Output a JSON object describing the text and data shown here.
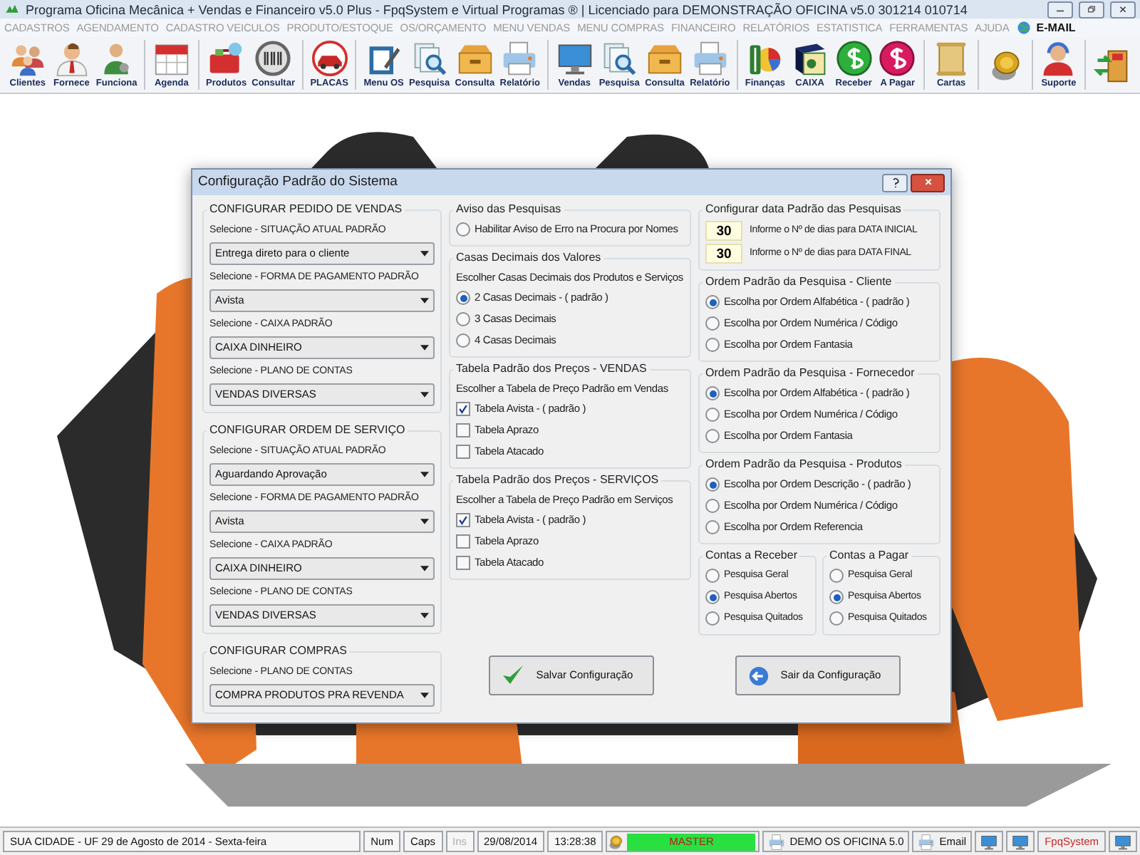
{
  "window": {
    "title": "Programa Oficina Mecânica + Vendas e Financeiro v5.0 Plus - FpqSystem e Virtual Programas ® | Licenciado para  DEMONSTRAÇÃO OFICINA v5.0 301214 010714"
  },
  "menu": {
    "items": [
      "CADASTROS",
      "AGENDAMENTO",
      "CADASTRO VEICULOS",
      "PRODUTO/ESTOQUE",
      "OS/ORÇAMENTO",
      "MENU VENDAS",
      "MENU COMPRAS",
      "FINANCEIRO",
      "RELATÓRIOS",
      "ESTATISTICA",
      "FERRAMENTAS",
      "AJUDA"
    ],
    "email": "E-MAIL"
  },
  "toolbar": [
    [
      {
        "label": "Clientes",
        "kind": "people"
      },
      {
        "label": "Fornece",
        "kind": "person"
      },
      {
        "label": "Funciona",
        "kind": "worker"
      }
    ],
    [
      {
        "label": "Agenda",
        "kind": "calendar"
      }
    ],
    [
      {
        "label": "Produtos",
        "kind": "toolbox"
      },
      {
        "label": "Consultar",
        "kind": "barcode"
      }
    ],
    [
      {
        "label": "PLACAS",
        "kind": "car"
      }
    ],
    [
      {
        "label": "Menu OS",
        "kind": "clipboard"
      },
      {
        "label": "Pesquisa",
        "kind": "magnifier"
      },
      {
        "label": "Consulta",
        "kind": "drawer"
      },
      {
        "label": "Relatório",
        "kind": "printer"
      }
    ],
    [
      {
        "label": "Vendas",
        "kind": "monitor"
      },
      {
        "label": "Pesquisa",
        "kind": "magnifier"
      },
      {
        "label": "Consulta",
        "kind": "drawer"
      },
      {
        "label": "Relatório",
        "kind": "printer"
      }
    ],
    [
      {
        "label": "Finanças",
        "kind": "money-chart"
      },
      {
        "label": "CAIXA",
        "kind": "book"
      },
      {
        "label": "Receber",
        "kind": "coin-green"
      },
      {
        "label": "A Pagar",
        "kind": "coin-red"
      }
    ],
    [
      {
        "label": "Cartas",
        "kind": "scroll"
      }
    ],
    [
      {
        "kind": "coins"
      }
    ],
    [
      {
        "label": "Suporte",
        "kind": "support"
      }
    ],
    [
      {
        "kind": "exit"
      }
    ]
  ],
  "dialog": {
    "title": "Configuração Padrão do Sistema",
    "left": [
      {
        "title": "CONFIGURAR PEDIDO DE VENDAS",
        "items": [
          {
            "kind": "select",
            "label": "Selecione - SITUAÇÃO ATUAL PADRÃO",
            "value": "Entrega direto para o cliente"
          },
          {
            "kind": "select",
            "label": "Selecione - FORMA DE PAGAMENTO PADRÃO",
            "value": "Avista"
          },
          {
            "kind": "select",
            "label": "Selecione - CAIXA PADRÃO",
            "value": "CAIXA DINHEIRO"
          },
          {
            "kind": "select",
            "label": "Selecione - PLANO DE CONTAS",
            "value": "VENDAS DIVERSAS"
          }
        ]
      },
      {
        "title": "CONFIGURAR ORDEM DE SERVIÇO",
        "items": [
          {
            "kind": "select",
            "label": "Selecione - SITUAÇÃO ATUAL PADRÃO",
            "value": "Aguardando Aprovação"
          },
          {
            "kind": "select",
            "label": "Selecione - FORMA DE PAGAMENTO PADRÃO",
            "value": "Avista"
          },
          {
            "kind": "select",
            "label": "Selecione - CAIXA PADRÃO",
            "value": "CAIXA DINHEIRO"
          },
          {
            "kind": "select",
            "label": "Selecione - PLANO DE CONTAS",
            "value": "VENDAS DIVERSAS"
          }
        ]
      },
      {
        "title": "CONFIGURAR COMPRAS",
        "items": [
          {
            "kind": "select",
            "label": "Selecione - PLANO DE CONTAS",
            "value": "COMPRA PRODUTOS PRA REVENDA"
          }
        ]
      }
    ],
    "middle": [
      {
        "title": "Aviso das Pesquisas",
        "items": [
          {
            "kind": "radio",
            "label": "Habilitar Aviso de Erro na Procura por Nomes",
            "selected": false
          }
        ]
      },
      {
        "title": "Casas Decimais dos Valores",
        "items": [
          {
            "kind": "text",
            "label": "Escolher Casas Decimais dos Produtos e Serviços"
          },
          {
            "kind": "radio",
            "label": "2 Casas Decimais - ( padrão )",
            "selected": true
          },
          {
            "kind": "radio",
            "label": "3 Casas Decimais",
            "selected": false
          },
          {
            "kind": "radio",
            "label": "4 Casas Decimais",
            "selected": false
          }
        ]
      },
      {
        "title": "Tabela Padrão dos Preços - VENDAS",
        "items": [
          {
            "kind": "text",
            "label": "Escolher a Tabela de Preço Padrão em Vendas"
          },
          {
            "kind": "checkbox",
            "label": "Tabela Avista - ( padrão )",
            "checked": true
          },
          {
            "kind": "checkbox",
            "label": "Tabela Aprazo",
            "checked": false
          },
          {
            "kind": "checkbox",
            "label": "Tabela Atacado",
            "checked": false
          }
        ]
      },
      {
        "title": "Tabela Padrão dos Preços - SERVIÇOS",
        "items": [
          {
            "kind": "text",
            "label": "Escolher a Tabela de Preço Padrão em Serviços"
          },
          {
            "kind": "checkbox",
            "label": "Tabela Avista - ( padrão )",
            "checked": true
          },
          {
            "kind": "checkbox",
            "label": "Tabela Aprazo",
            "checked": false
          },
          {
            "kind": "checkbox",
            "label": "Tabela Atacado",
            "checked": false
          }
        ]
      }
    ],
    "right": [
      {
        "title": "Configurar data Padrão das Pesquisas",
        "items": [
          {
            "kind": "number",
            "value": "30",
            "label": "Informe o Nº de dias para DATA INICIAL"
          },
          {
            "kind": "number",
            "value": "30",
            "label": "Informe o Nº de dias para DATA FINAL"
          }
        ]
      },
      {
        "title": "Ordem Padrão da Pesquisa - Cliente",
        "items": [
          {
            "kind": "radio",
            "label": "Escolha por Ordem Alfabética - ( padrão )",
            "selected": true
          },
          {
            "kind": "radio",
            "label": "Escolha por Ordem Numérica / Código",
            "selected": false
          },
          {
            "kind": "radio",
            "label": "Escolha por Ordem Fantasia",
            "selected": false
          }
        ]
      },
      {
        "title": "Ordem Padrão da Pesquisa - Fornecedor",
        "items": [
          {
            "kind": "radio",
            "label": "Escolha por Ordem Alfabética - ( padrão )",
            "selected": true
          },
          {
            "kind": "radio",
            "label": "Escolha por Ordem Numérica / Código",
            "selected": false
          },
          {
            "kind": "radio",
            "label": "Escolha por Ordem Fantasia",
            "selected": false
          }
        ]
      },
      {
        "title": "Ordem Padrão da Pesquisa - Produtos",
        "items": [
          {
            "kind": "radio",
            "label": "Escolha por Ordem Descrição - ( padrão )",
            "selected": true
          },
          {
            "kind": "radio",
            "label": "Escolha por Ordem Numérica / Código",
            "selected": false
          },
          {
            "kind": "radio",
            "label": "Escolha por Ordem Referencia",
            "selected": false
          }
        ]
      }
    ],
    "right_pair": [
      {
        "title": "Contas a Receber",
        "items": [
          {
            "kind": "radio",
            "label": "Pesquisa Geral",
            "selected": false
          },
          {
            "kind": "radio",
            "label": "Pesquisa Abertos",
            "selected": true
          },
          {
            "kind": "radio",
            "label": "Pesquisa Quitados",
            "selected": false
          }
        ]
      },
      {
        "title": "Contas a Pagar",
        "items": [
          {
            "kind": "radio",
            "label": "Pesquisa Geral",
            "selected": false
          },
          {
            "kind": "radio",
            "label": "Pesquisa Abertos",
            "selected": true
          },
          {
            "kind": "radio",
            "label": "Pesquisa Quitados",
            "selected": false
          }
        ]
      }
    ],
    "buttons": [
      {
        "kind": "save",
        "label": "Salvar Configuração"
      },
      {
        "kind": "exit",
        "label": "Sair da Configuração"
      }
    ]
  },
  "status_bar": [
    {
      "kind": "text",
      "text": "SUA CIDADE - UF 29 de Agosto de 2014 - Sexta-feira",
      "disabled": false
    },
    {
      "kind": "text",
      "text": "Num",
      "disabled": false
    },
    {
      "kind": "text",
      "text": "Caps",
      "disabled": false
    },
    {
      "kind": "text",
      "text": "Ins",
      "disabled": true
    },
    {
      "kind": "text",
      "text": "29/08/2014",
      "disabled": false
    },
    {
      "kind": "text",
      "text": "13:28:38",
      "disabled": false
    },
    {
      "kind": "badge",
      "text": "MASTER"
    },
    {
      "kind": "icon-text",
      "text": "DEMO OS OFICINA 5.0"
    },
    {
      "kind": "icon-text",
      "text": "Email"
    },
    {
      "kind": "icon"
    },
    {
      "kind": "icon"
    },
    {
      "kind": "brand",
      "text": "FpqSystem"
    },
    {
      "kind": "icon"
    }
  ]
}
